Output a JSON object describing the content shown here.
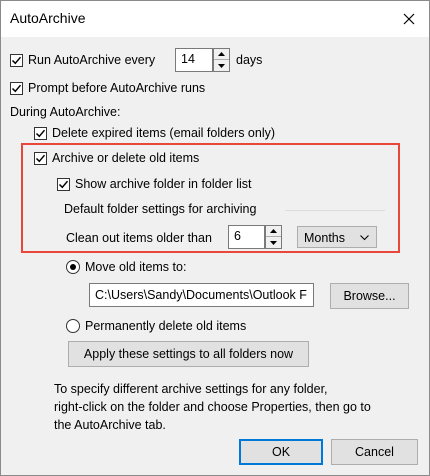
{
  "window": {
    "title": "AutoArchive"
  },
  "run_autoarchive": {
    "checked": true,
    "label": "Run AutoArchive every",
    "value": "14",
    "unit": "days"
  },
  "prompt_before": {
    "checked": true,
    "label": "Prompt before AutoArchive runs"
  },
  "during_label": "During AutoArchive:",
  "delete_expired": {
    "checked": true,
    "label": "Delete expired items (email folders only)"
  },
  "archive_old": {
    "checked": true,
    "label": "Archive or delete old items"
  },
  "show_folder": {
    "checked": true,
    "label": "Show archive folder in folder list"
  },
  "default_group_label": "Default folder settings for archiving",
  "clean_out": {
    "label": "Clean out items older than",
    "value": "6",
    "unit_selected": "Months"
  },
  "move_old": {
    "selected": true,
    "label": "Move old items to:",
    "path": "C:\\Users\\Sandy\\Documents\\Outlook F",
    "browse_label": "Browse..."
  },
  "perm_delete": {
    "selected": false,
    "label": "Permanently delete old items"
  },
  "apply_all_label": "Apply these settings to all folders now",
  "info_text": [
    "To specify different archive settings for any folder,",
    "right-click on the folder and choose Properties, then go to",
    "the AutoArchive tab."
  ],
  "buttons": {
    "ok": "OK",
    "cancel": "Cancel"
  },
  "colors": {
    "highlight": "#e8473a",
    "default_button_border": "#0078d7"
  }
}
